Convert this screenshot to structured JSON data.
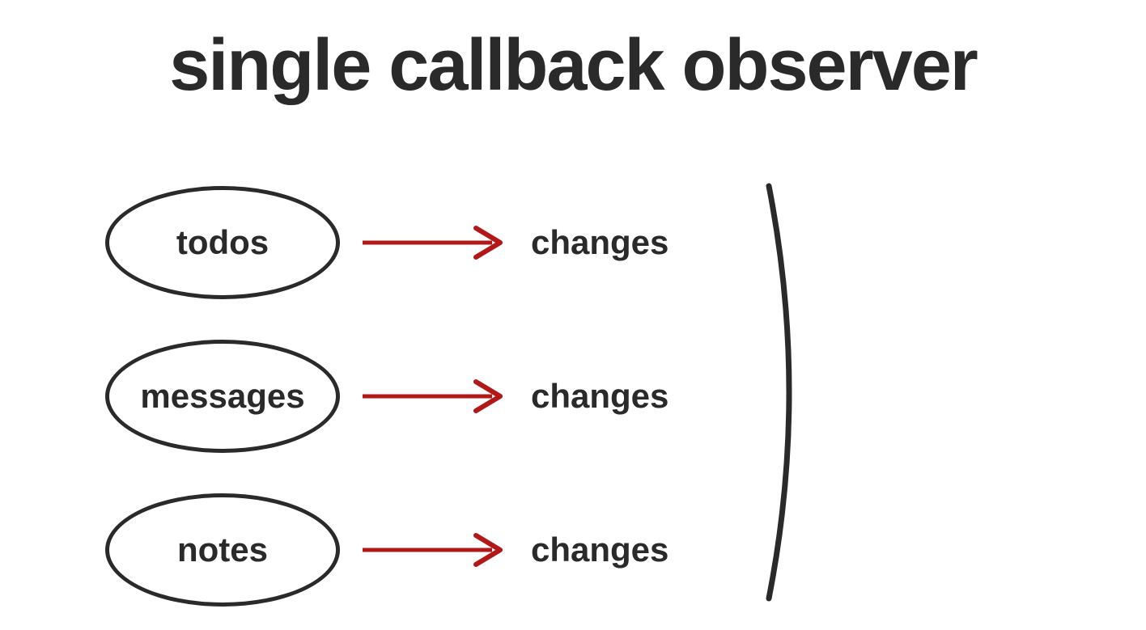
{
  "title": "single callback observer",
  "rows": [
    {
      "source": "todos",
      "target": "changes"
    },
    {
      "source": "messages",
      "target": "changes"
    },
    {
      "source": "notes",
      "target": "changes"
    }
  ],
  "colors": {
    "text": "#2a2a2a",
    "arrow": "#b21818",
    "bg": "#ffffff"
  }
}
